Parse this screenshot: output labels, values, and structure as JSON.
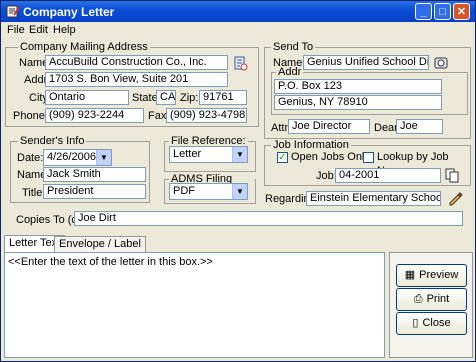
{
  "window": {
    "title": "Company Letter"
  },
  "menu": [
    "File",
    "Edit",
    "Help"
  ],
  "mailing": {
    "group_label": "Company Mailing Address",
    "name_label": "Name:",
    "name": "AccuBuild Construction Co., Inc.",
    "addr_label": "Addr:",
    "addr": "1703 S. Bon View, Suite 201",
    "city_label": "City:",
    "city": "Ontario",
    "state_label": "State:",
    "state": "CA",
    "zip_label": "Zip:",
    "zip": "91761",
    "phone_label": "Phone:",
    "phone": "(909) 923-2244",
    "fax_label": "Fax:",
    "fax": "(909) 923-4798"
  },
  "sendto": {
    "group_label": "Send To",
    "name_label": "Name:",
    "name": "Genius Unified School District",
    "addr_label": "Addr",
    "addr_line1": "P.O. Box 123",
    "addr_line2": "Genius, NY 78910",
    "attn_label": "Attn:",
    "attn": "Joe Director",
    "dear_label": "Dear:",
    "dear": "Joe"
  },
  "sender": {
    "group_label": "Sender's Info",
    "date_label": "Date:",
    "date": "4/26/2006",
    "name_label": "Name:",
    "name": "Jack Smith",
    "title_label": "Title:",
    "title": "President"
  },
  "file_reference": {
    "group_label": "File Reference:",
    "value": "Letter"
  },
  "adms": {
    "group_label": "ADMS Filing Options",
    "value": "PDF"
  },
  "job": {
    "group_label": "Job Information",
    "open_jobs_label": "Open Jobs Only",
    "open_jobs_checked": true,
    "lookup_label": "Lookup by Job Name",
    "lookup_checked": false,
    "job_label": "Job:",
    "job": "04-2001",
    "regarding_label": "Regarding:",
    "regarding": "Einstein Elementary School"
  },
  "copies": {
    "label": "Copies To (cc:)",
    "value": "Joe Dirt"
  },
  "tabs": [
    "Letter Text",
    "Envelope / Label"
  ],
  "letter_text": "<<Enter the text of the letter in this box.>>",
  "actions": {
    "preview": "Preview",
    "print": "Print",
    "close": "Close"
  }
}
